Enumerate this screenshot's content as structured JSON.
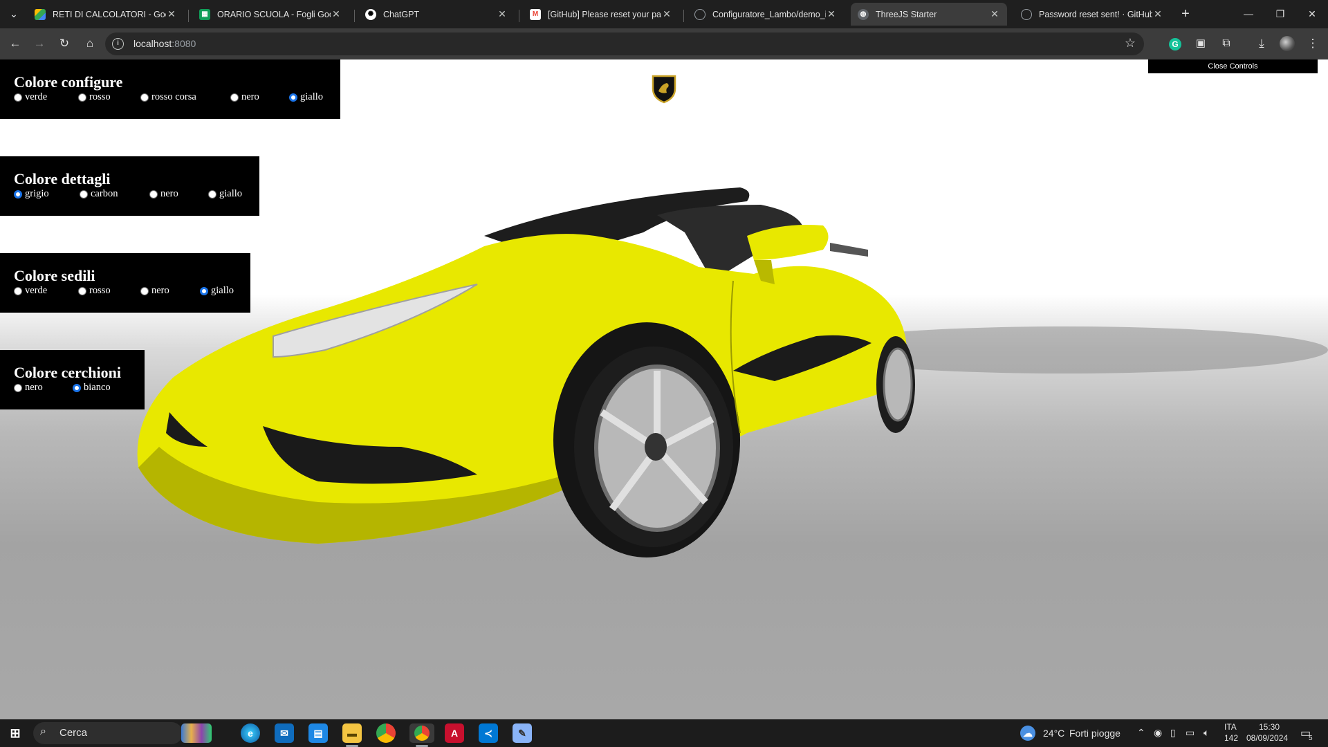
{
  "browser": {
    "tabs": [
      {
        "title": "RETI DI CALCOLATORI - Google",
        "icon": "google-drive-icon",
        "active": false
      },
      {
        "title": "ORARIO SCUOLA - Fogli Google",
        "icon": "google-sheets-icon",
        "active": false
      },
      {
        "title": "ChatGPT",
        "icon": "chatgpt-icon",
        "active": false
      },
      {
        "title": "[GitHub] Please reset your pass",
        "icon": "gmail-icon",
        "active": false
      },
      {
        "title": "Configuratore_Lambo/demo_in",
        "icon": "github-icon",
        "active": false
      },
      {
        "title": "ThreeJS Starter",
        "icon": "globe-icon",
        "active": true
      },
      {
        "title": "Password reset sent! · GitHub",
        "icon": "github-icon",
        "active": false
      }
    ],
    "url_host": "localhost",
    "url_port": ":8080"
  },
  "page": {
    "close_controls_label": "Close Controls",
    "panels": [
      {
        "title": "Colore configure",
        "options": [
          {
            "label": "verde",
            "checked": false
          },
          {
            "label": "rosso",
            "checked": false
          },
          {
            "label": "rosso corsa",
            "checked": false
          },
          {
            "label": "nero",
            "checked": false
          },
          {
            "label": "giallo",
            "checked": true
          }
        ]
      },
      {
        "title": "Colore dettagli",
        "options": [
          {
            "label": "grigio",
            "checked": true
          },
          {
            "label": "carbon",
            "checked": false
          },
          {
            "label": "nero",
            "checked": false
          },
          {
            "label": "giallo",
            "checked": false
          }
        ]
      },
      {
        "title": "Colore sedili",
        "options": [
          {
            "label": "verde",
            "checked": false
          },
          {
            "label": "rosso",
            "checked": false
          },
          {
            "label": "nero",
            "checked": false
          },
          {
            "label": "giallo",
            "checked": true
          }
        ]
      },
      {
        "title": "Colore cerchioni",
        "options": [
          {
            "label": "nero",
            "checked": false
          },
          {
            "label": "bianco",
            "checked": true
          }
        ]
      }
    ],
    "colors": {
      "car_body": "#e8e800",
      "car_shadow": "#b5b500",
      "accent": "#1a73e8"
    }
  },
  "taskbar": {
    "search_placeholder": "Cerca",
    "weather_temp": "24°C",
    "weather_text": "Forti piogge",
    "language": "ITA",
    "keyboard": "142",
    "time": "15:30",
    "date": "08/09/2024",
    "notification_count": "5"
  }
}
